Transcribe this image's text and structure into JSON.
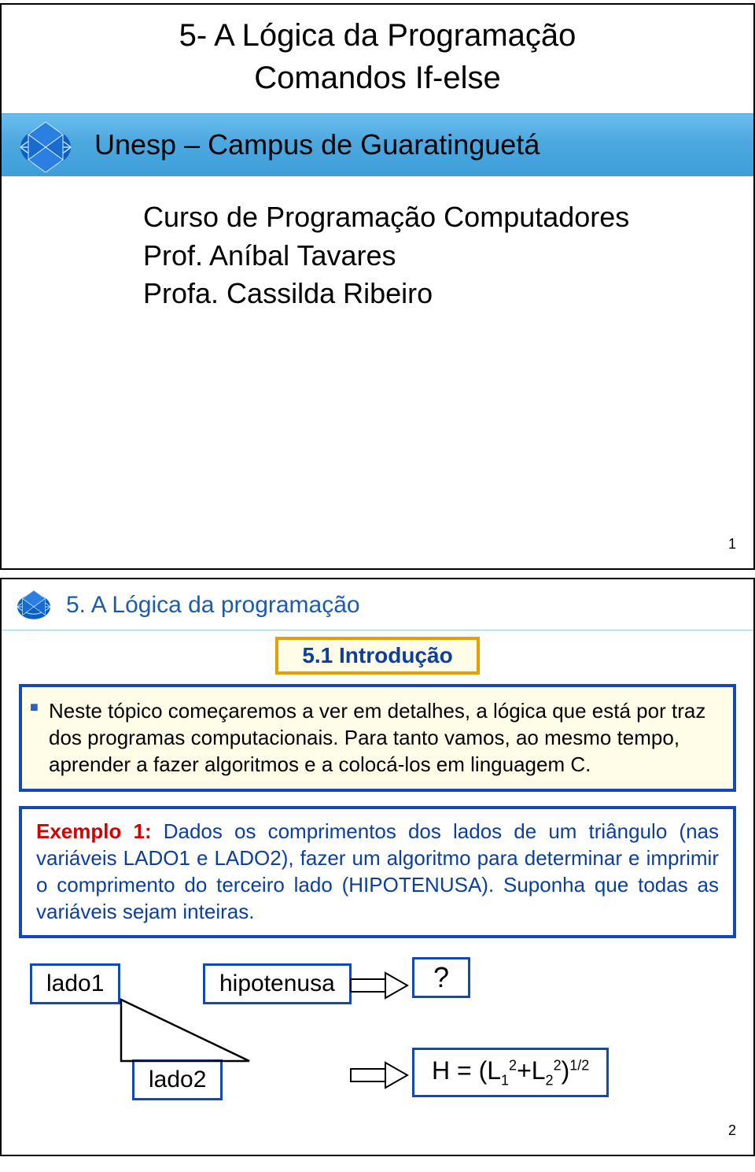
{
  "slide1": {
    "title_line1": "5- A Lógica da Programação",
    "title_line2": "Comandos If-else",
    "band_text": "Unesp – Campus de Guaratinguetá",
    "course_line1": "Curso de Programação Computadores",
    "course_line2": "Prof. Aníbal Tavares",
    "course_line3": "Profa. Cassilda Ribeiro",
    "page": "1"
  },
  "slide2": {
    "header": "5. A Lógica da programação",
    "intro": "5.1 Introdução",
    "note": "Neste tópico começaremos a ver em detalhes, a lógica que está por traz dos programas computacionais. Para tanto vamos, ao mesmo tempo, aprender a fazer algoritmos e a colocá-los em linguagem C.",
    "example_label": "Exemplo 1:",
    "example_body": " Dados os comprimentos dos lados de um triângulo (nas variáveis LADO1 e LADO2), fazer um algoritmo para determinar e imprimir o comprimento do terceiro lado (HIPOTENUSA). Suponha que todas as variáveis sejam inteiras.",
    "lado1": "lado1",
    "lado2": "lado2",
    "hipotenusa": "hipotenusa",
    "qmark": "?",
    "formula_prefix": "H = (L",
    "formula_sub1": "1",
    "formula_sup1": "2",
    "formula_plus": "+L",
    "formula_sub2": "2",
    "formula_sup2": "2",
    "formula_close": ")",
    "formula_exp": "1/2",
    "page": "2"
  }
}
